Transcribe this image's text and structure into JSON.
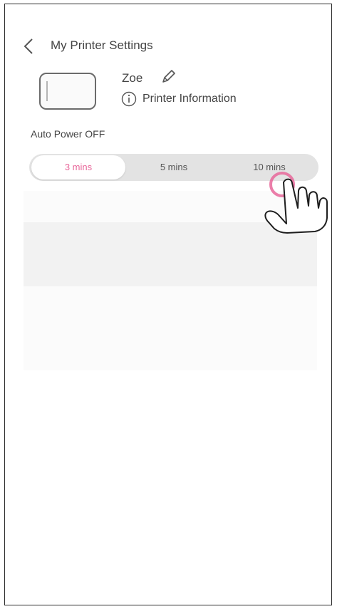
{
  "header": {
    "title": "My Printer Settings",
    "back_icon": "chevron-left-icon"
  },
  "printer": {
    "name": "Zoe",
    "edit_icon": "pencil-icon",
    "info_icon": "info-icon",
    "info_label": "Printer Information"
  },
  "auto_power_off": {
    "label": "Auto Power OFF",
    "options": [
      "3 mins",
      "5 mins",
      "10 mins"
    ],
    "selected": "3 mins"
  },
  "colors": {
    "accent": "#e8679a",
    "segment_bg": "#e3e3e3"
  },
  "overlay": {
    "hand_icon": "tap-hand-icon"
  }
}
